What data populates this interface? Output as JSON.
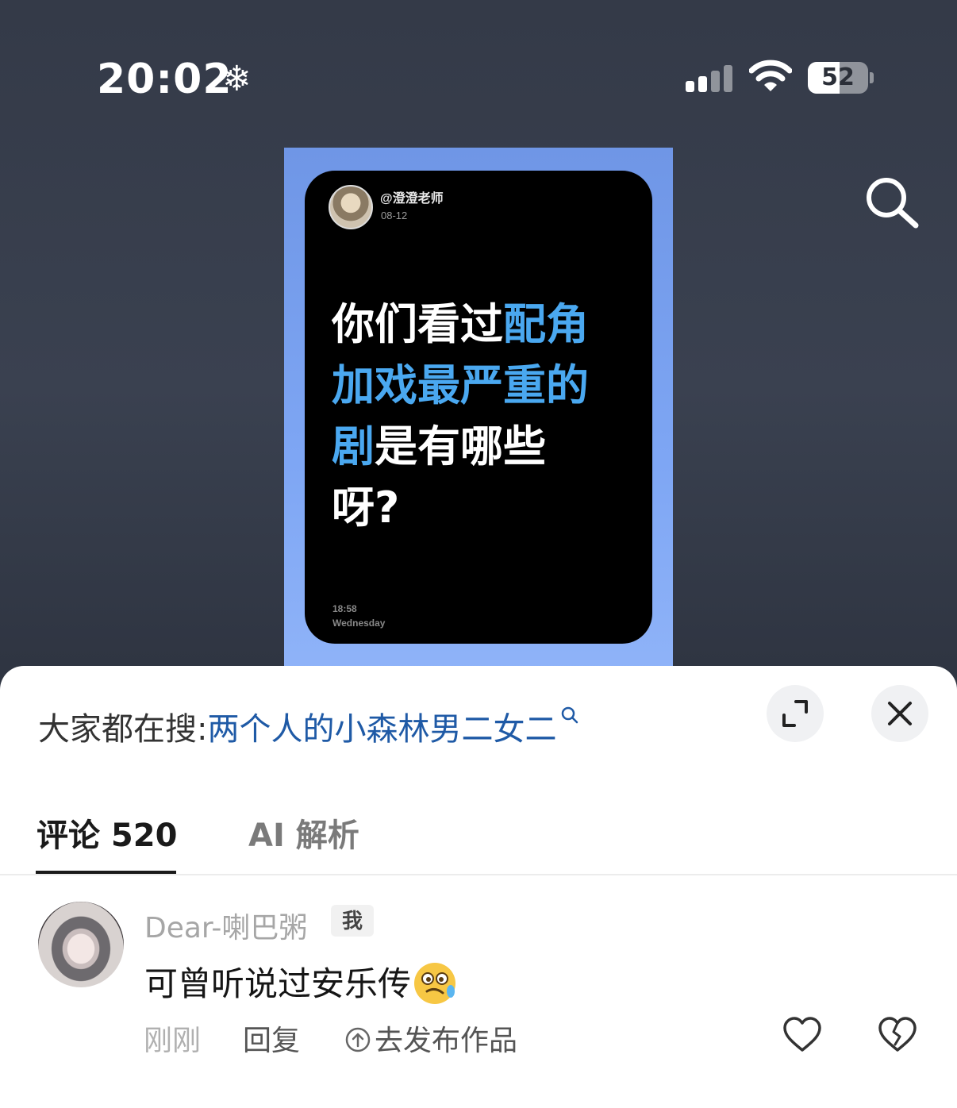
{
  "status_bar": {
    "time": "20:02",
    "focus_icon": "snowflake-icon",
    "battery_level": "52",
    "battery_percent": 52
  },
  "post": {
    "handle": "@澄澄老师",
    "date": "08-12",
    "title_parts": [
      {
        "text": "你们看过",
        "highlight": false
      },
      {
        "text": "配角加戏最严重的剧",
        "highlight": true
      },
      {
        "text": "是有哪些呀?",
        "highlight": false
      }
    ],
    "title_lines": [
      "你们看过配角",
      "加戏最严重的",
      "剧是有哪些",
      "呀?"
    ],
    "clock": "18:58",
    "weekday": "Wednesday",
    "highlight_color": "#4aa8f0",
    "frame_color": "#7ea6f4"
  },
  "sheet": {
    "trending_prefix": "大家都在搜:",
    "trending_query": "两个人的小森林男二女二",
    "tabs": [
      {
        "label": "评论 520",
        "active": true
      },
      {
        "label": "AI 解析",
        "active": false
      }
    ],
    "comments": [
      {
        "username": "Dear-喇巴粥",
        "badge": "我",
        "text": "可曾听说过安乐传",
        "emoji": "woozy-face-emoji",
        "time": "刚刚",
        "reply_label": "回复",
        "publish_label": "去发布作品"
      }
    ]
  },
  "colors": {
    "link": "#1f5aa6",
    "background_top": "#343a48"
  }
}
